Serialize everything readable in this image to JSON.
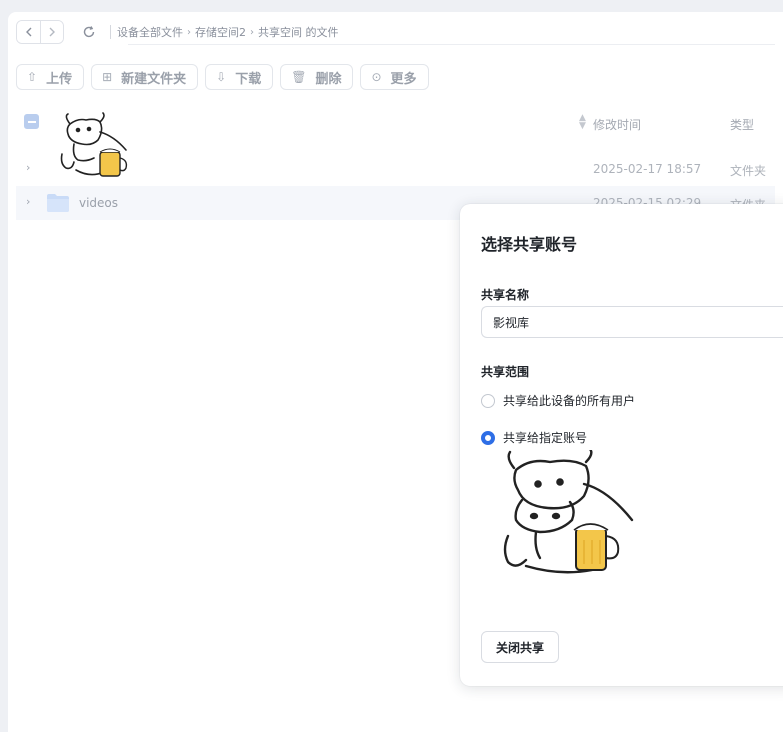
{
  "breadcrumb": {
    "items": [
      "设备全部文件",
      "存储空间2",
      "共享空间 的文件"
    ]
  },
  "toolbar": {
    "upload": "上传",
    "new_folder": "新建文件夹",
    "download": "下载",
    "delete": "删除",
    "more": "更多"
  },
  "list": {
    "columns": {
      "mtime": "修改时间",
      "type": "类型"
    },
    "rows": [
      {
        "name": "",
        "mtime": "2025-02-17 18:57",
        "type": "文件夹"
      },
      {
        "name": "videos",
        "mtime": "2025-02-15 02:29",
        "type": "文件夹"
      }
    ]
  },
  "modal": {
    "title": "选择共享账号",
    "name_label": "共享名称",
    "name_value": "影视库",
    "scope_label": "共享范围",
    "option_all": "共享给此设备的所有用户",
    "option_specific": "共享给指定账号",
    "close_button": "关闭共享"
  },
  "colors": {
    "accent": "#2e6ee6",
    "folder": "#c9dbf7"
  }
}
